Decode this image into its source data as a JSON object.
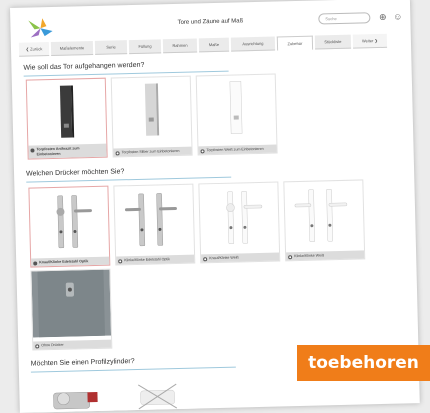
{
  "header": {
    "title": "Tore und Zäune auf Maß",
    "search_placeholder": "Suche",
    "help_icon": "help-icon",
    "user_icon": "user-icon",
    "brand_colors": [
      "#8bc34a",
      "#f2a72b",
      "#9c6fc2",
      "#3a9ad9"
    ]
  },
  "tabs": [
    {
      "label": "❮  Zurück",
      "kind": "prev"
    },
    {
      "label": "Maßelemente"
    },
    {
      "label": "Serie"
    },
    {
      "label": "Füllung"
    },
    {
      "label": "Rahmen"
    },
    {
      "label": "Maße"
    },
    {
      "label": "Ausrichtung"
    },
    {
      "label": "Zubehör",
      "active": true
    },
    {
      "label": "Stückliste"
    },
    {
      "label": "Weiter  ❯",
      "kind": "next"
    }
  ],
  "sections": [
    {
      "title": "Wie soll das Tor aufgehangen werden?",
      "options": [
        {
          "label": "Torpfosten Anthrazit zum Einbetonieren",
          "selected": true,
          "image": "post-anthracite"
        },
        {
          "label": "Torpfosten Silber zum Einbetonieren",
          "selected": false,
          "image": "post-silver"
        },
        {
          "label": "Torpfosten Weiß zum Einbetonieren",
          "selected": false,
          "image": "post-white"
        }
      ]
    },
    {
      "title": "Welchen Drücker möchten Sie?",
      "options": [
        {
          "label": "Knauf/Klinke Edelstahl Optik",
          "selected": true,
          "image": "handle-knob-steel"
        },
        {
          "label": "Klinke/Klinke Edelstahl Optik",
          "selected": false,
          "image": "handle-lever-steel"
        },
        {
          "label": "Knauf/Klinke Weiß",
          "selected": false,
          "image": "handle-knob-white"
        },
        {
          "label": "Klinke/Klinke Weiß",
          "selected": false,
          "image": "handle-lever-white"
        },
        {
          "label": "Ohne Drücker",
          "selected": false,
          "image": "no-handle"
        }
      ]
    },
    {
      "title": "Möchten Sie einen Profilzylinder?",
      "options": [
        {
          "label": "",
          "image": "profile-cylinder"
        },
        {
          "label": "",
          "image": "no-cylinder"
        }
      ]
    }
  ],
  "badge": {
    "label": "toebehoren",
    "color": "#f07d19"
  }
}
